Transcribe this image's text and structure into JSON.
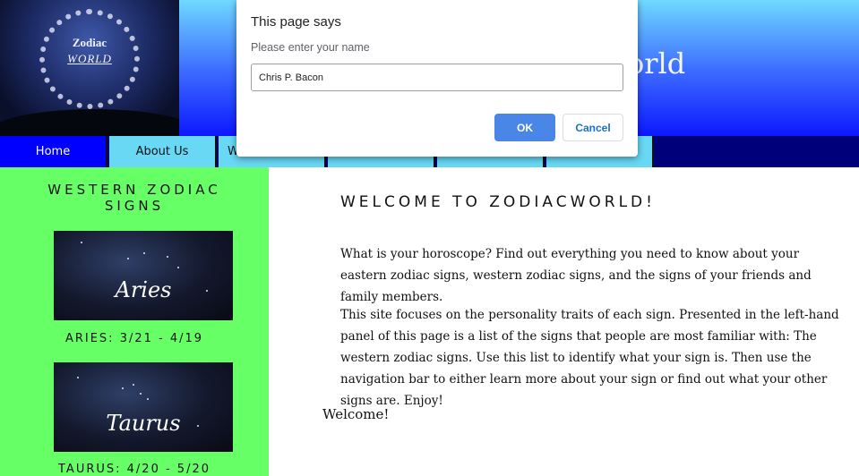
{
  "header": {
    "logo": {
      "line1": "Zodiac",
      "line2": "WORLD"
    },
    "site_title": "ZodiacWorld"
  },
  "nav": {
    "items": [
      {
        "label": "Home",
        "active": true
      },
      {
        "label": "About Us",
        "active": false
      },
      {
        "label": "W",
        "active": false
      },
      {
        "label": "",
        "active": false
      },
      {
        "label": "",
        "active": false
      },
      {
        "label": "",
        "active": false
      }
    ]
  },
  "sidebar": {
    "heading": "WESTERN ZODIAC SIGNS",
    "signs": [
      {
        "image_label": "Aries",
        "caption": "ARIES: 3/21 - 4/19"
      },
      {
        "image_label": "Taurus",
        "caption": "TAURUS: 4/20 - 5/20"
      }
    ]
  },
  "main": {
    "heading": "WELCOME TO ZODIACWORLD!",
    "paragraphs": [
      "What is your horoscope? Find out everything you need to know about your eastern zodiac signs, western zodiac signs, and the signs of your friends and family members.",
      "This site focuses on the personality traits of each sign. Presented in the left-hand panel of this page is a list of the signs that people are most familiar with: The western zodiac signs. Use this list to identify what your sign is. Then use the navigation bar to either learn more about your sign or find out what your other signs are. Enjoy!"
    ],
    "welcome": "Welcome!"
  },
  "dialog": {
    "title": "This page says",
    "message": "Please enter your name",
    "input_value": "Chris P. Bacon",
    "ok_label": "OK",
    "cancel_label": "Cancel"
  },
  "colors": {
    "header_top": "#6fd9ff",
    "header_bottom": "#0b18ff",
    "nav_bg": "#00007a",
    "nav_item": "#68d8f5",
    "nav_active": "#0000ff",
    "sidebar": "#66ff66",
    "ok_button": "#4a86e8"
  }
}
